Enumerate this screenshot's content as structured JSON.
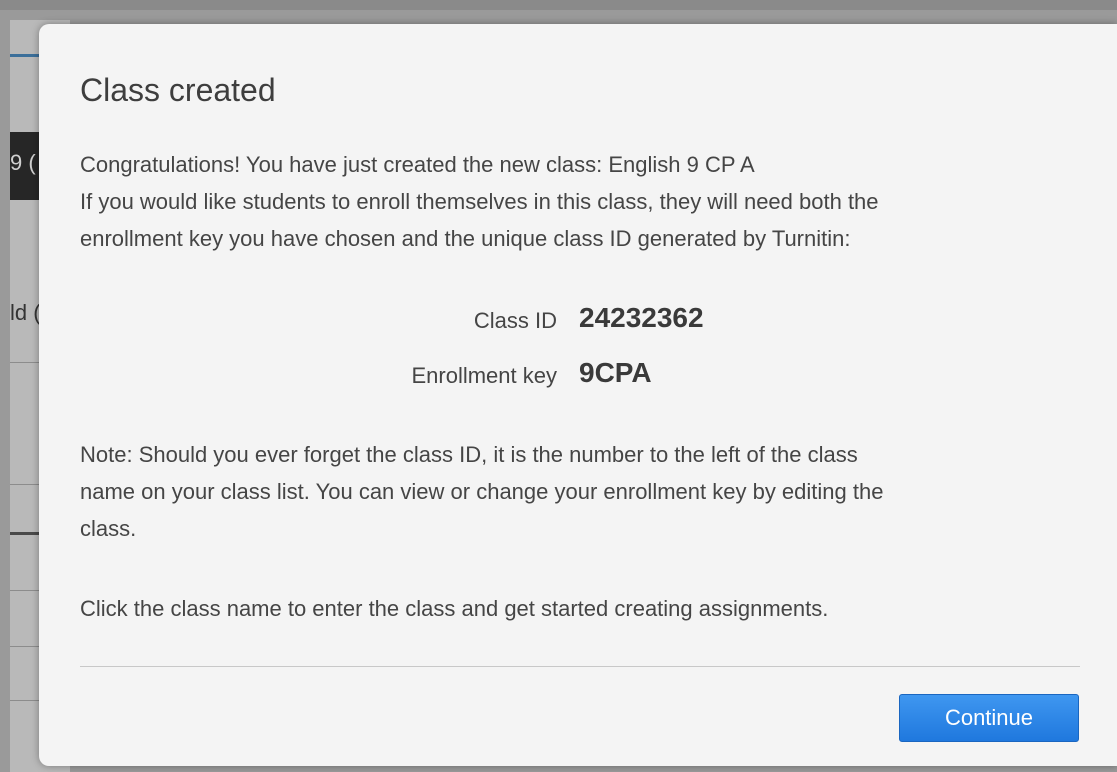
{
  "background": {
    "partial_text_1": "9 (",
    "partial_text_2": "ld ("
  },
  "modal": {
    "title": "Class created",
    "congrats_line": "Congratulations! You have just created the new class: English 9 CP A",
    "enroll_line_1": "If you would like students to enroll themselves in this class, they will need both the",
    "enroll_line_2": "enrollment key you have chosen and the unique class ID generated by Turnitin:",
    "class_id_label": "Class ID",
    "class_id_value": "24232362",
    "enrollment_key_label": "Enrollment key",
    "enrollment_key_value": "9CPA",
    "note_line_1": "Note: Should you ever forget the class ID, it is the number to the left of the class",
    "note_line_2": "name on your class list. You can view or change your enrollment key by editing the",
    "note_line_3": "class.",
    "instruction": "Click the class name to enter the class and get started creating assignments.",
    "continue_label": "Continue"
  },
  "colors": {
    "button_blue": "#2a86e8",
    "modal_bg": "#f4f4f4"
  }
}
